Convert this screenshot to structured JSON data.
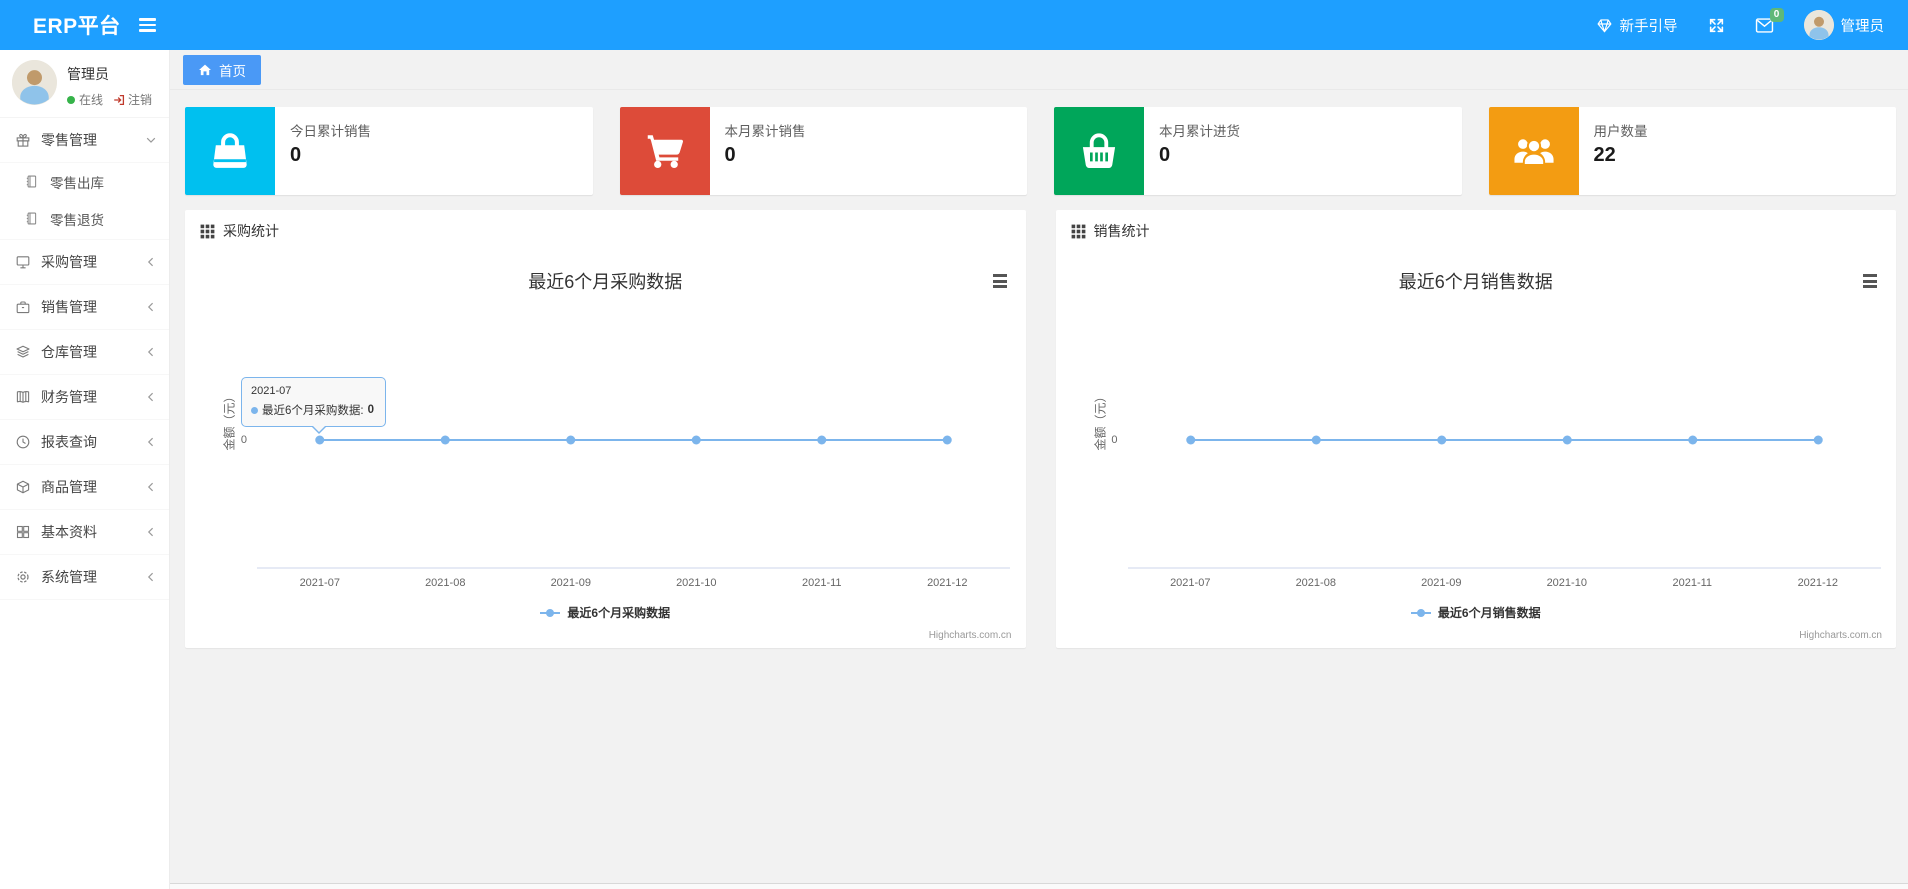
{
  "navbar": {
    "brand": "ERP平台",
    "guide_label": "新手引导",
    "message_badge": "0",
    "user_name": "管理员"
  },
  "sidebar": {
    "user": {
      "name": "管理员",
      "status_label": "在线",
      "logout_label": "注销"
    },
    "menu": [
      {
        "label": "零售管理",
        "icon": "gift-icon",
        "expanded": true,
        "children": [
          {
            "label": "零售出库",
            "icon": "file-icon"
          },
          {
            "label": "零售退货",
            "icon": "file-icon"
          }
        ]
      },
      {
        "label": "采购管理",
        "icon": "monitor-icon"
      },
      {
        "label": "销售管理",
        "icon": "briefcase-icon"
      },
      {
        "label": "仓库管理",
        "icon": "layers-icon"
      },
      {
        "label": "财务管理",
        "icon": "book-icon"
      },
      {
        "label": "报表查询",
        "icon": "clock-icon"
      },
      {
        "label": "商品管理",
        "icon": "package-icon"
      },
      {
        "label": "基本资料",
        "icon": "grid-icon"
      },
      {
        "label": "系统管理",
        "icon": "gear-icon"
      }
    ]
  },
  "tabbar": {
    "home_tab": "首页"
  },
  "stat_cards": [
    {
      "label": "今日累计销售",
      "value": "0",
      "icon": "shopping-bag-icon",
      "color": "#00c0ef"
    },
    {
      "label": "本月累计销售",
      "value": "0",
      "icon": "shopping-cart-icon",
      "color": "#dd4b39"
    },
    {
      "label": "本月累计进货",
      "value": "0",
      "icon": "shopping-basket-icon",
      "color": "#00a65a"
    },
    {
      "label": "用户数量",
      "value": "22",
      "icon": "users-icon",
      "color": "#f39c12"
    }
  ],
  "panels": [
    {
      "title": "采购统计"
    },
    {
      "title": "销售统计"
    }
  ],
  "chart_data": [
    {
      "type": "line",
      "title": "最近6个月采购数据",
      "categories": [
        "2021-07",
        "2021-08",
        "2021-09",
        "2021-10",
        "2021-11",
        "2021-12"
      ],
      "series": [
        {
          "name": "最近6个月采购数据",
          "values": [
            0,
            0,
            0,
            0,
            0,
            0
          ],
          "color": "#7cb5ec"
        }
      ],
      "xlabel": "",
      "ylabel": "金额（元）",
      "yticks": [
        "0"
      ],
      "grid": false,
      "legend_position": "bottom",
      "credit": "Highcharts.com.cn",
      "tooltip": {
        "category": "2021-07",
        "series_name": "最近6个月采购数据:",
        "value": "0"
      }
    },
    {
      "type": "line",
      "title": "最近6个月销售数据",
      "categories": [
        "2021-07",
        "2021-08",
        "2021-09",
        "2021-10",
        "2021-11",
        "2021-12"
      ],
      "series": [
        {
          "name": "最近6个月销售数据",
          "values": [
            0,
            0,
            0,
            0,
            0,
            0
          ],
          "color": "#7cb5ec"
        }
      ],
      "xlabel": "",
      "ylabel": "金额（元）",
      "yticks": [
        "0"
      ],
      "grid": false,
      "legend_position": "bottom",
      "credit": "Highcharts.com.cn",
      "tooltip": null
    }
  ]
}
